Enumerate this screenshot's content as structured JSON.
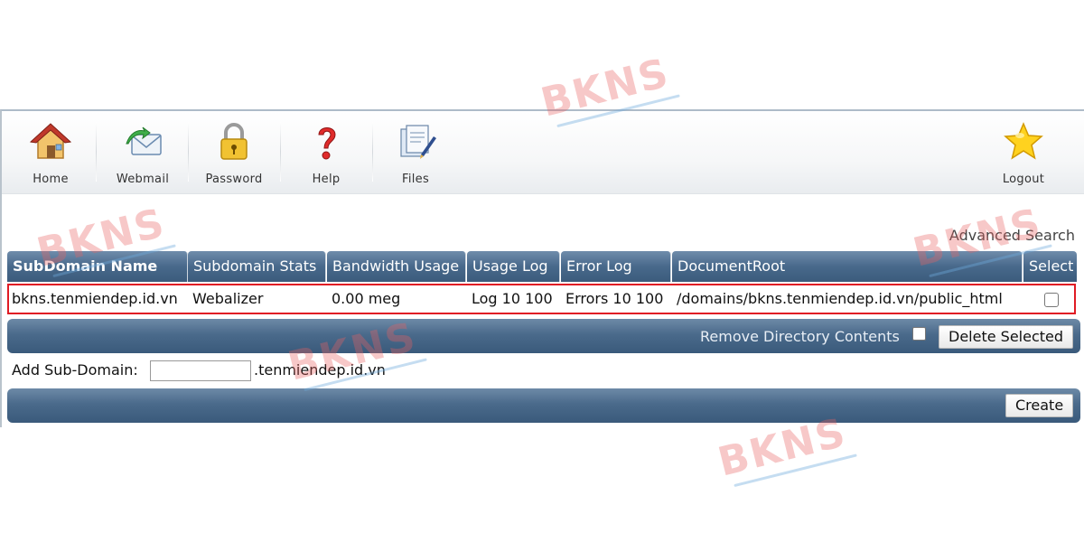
{
  "toolbar": {
    "items": [
      {
        "label": "Home",
        "icon": "home-icon"
      },
      {
        "label": "Webmail",
        "icon": "webmail-icon"
      },
      {
        "label": "Password",
        "icon": "lock-icon"
      },
      {
        "label": "Help",
        "icon": "help-icon"
      },
      {
        "label": "Files",
        "icon": "files-icon"
      }
    ],
    "logout": {
      "label": "Logout",
      "icon": "star-icon"
    }
  },
  "advanced_search": "Advanced Search",
  "table": {
    "headers": [
      "SubDomain Name",
      "Subdomain Stats",
      "Bandwidth Usage",
      "Usage Log",
      "Error Log",
      "DocumentRoot",
      "Select"
    ],
    "rows": [
      {
        "name": "bkns.tenmiendep.id.vn",
        "stats": "Webalizer",
        "bandwidth": "0.00 meg",
        "usage_log": "Log 10 100",
        "error_log": "Errors 10 100",
        "document_root": "/domains/bkns.tenmiendep.id.vn/public_html",
        "selected": false
      }
    ]
  },
  "actions": {
    "remove_contents_label": "Remove Directory Contents",
    "delete_button": "Delete Selected",
    "add_label": "Add Sub-Domain:",
    "add_value": "",
    "domain_suffix": ".tenmiendep.id.vn",
    "create_button": "Create"
  },
  "watermark": "BKNS",
  "colors": {
    "header_bar": "#48698b",
    "highlight_border": "#e01b24"
  }
}
